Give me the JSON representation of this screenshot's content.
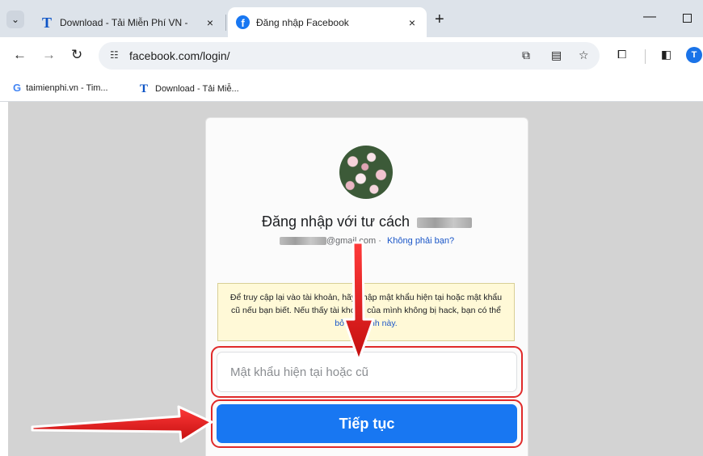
{
  "browser": {
    "tabs": [
      {
        "title": "Download - Tải Miễn Phí VN - ",
        "close": "×",
        "active": false
      },
      {
        "title": "Đăng nhập Facebook",
        "close": "×",
        "active": true
      }
    ],
    "tab_menu_glyph": "⌄",
    "new_tab": "+",
    "minimize": "—",
    "url": "facebook.com/login/",
    "profile_initial": "T",
    "bookmarks": [
      {
        "label": "taimienphi.vn - Tim...",
        "icon": "google-icon",
        "glyph": "G"
      },
      {
        "label": "Download - Tải Miễ...",
        "icon": "taimienphi-icon",
        "glyph": "T"
      }
    ]
  },
  "page": {
    "login_title": "Đăng nhập với tư cách",
    "email_suffix": "@gmail.com",
    "email_separator": "·",
    "not_you": "Không phải bạn?",
    "notice_text": "Để truy cập lại vào tài khoản, hãy nhập mật khẩu hiện tại hoặc mật khẩu cũ nếu bạn biết. Nếu thấy tài khoản của mình không bị hack, bạn có thể ",
    "notice_link": "bỏ quy trình này.",
    "password_placeholder": "Mật khẩu hiện tại hoặc cũ",
    "continue_label": "Tiếp tục"
  },
  "colors": {
    "facebook_blue": "#1877f2",
    "annotation_red": "#e02a2a",
    "notice_bg": "#fff9d7",
    "link_blue": "#1a56c8"
  },
  "annotations": [
    {
      "name": "arrow-to-password-field"
    },
    {
      "name": "arrow-to-continue-button"
    }
  ]
}
